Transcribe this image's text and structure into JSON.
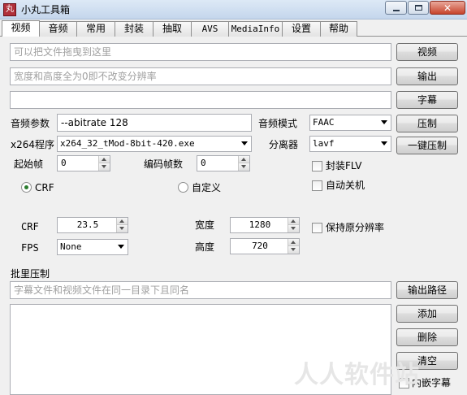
{
  "window": {
    "title": "小丸工具箱",
    "app_icon_text": "丸",
    "close": "✕"
  },
  "tabs": [
    "视频",
    "音频",
    "常用",
    "封装",
    "抽取",
    "AVS",
    "MediaInfo",
    "设置",
    "帮助"
  ],
  "video": {
    "drop_placeholder": "可以把文件拖曳到这里",
    "size_placeholder": "宽度和高度全为0即不改变分辨率",
    "subtitle_value": "",
    "btn_video": "视频",
    "btn_output": "输出",
    "btn_subtitle": "字幕",
    "audio_params_label": "音频参数",
    "audio_params_value": "--abitrate 128",
    "audio_mode_label": "音频模式",
    "audio_mode_value": "FAAC",
    "btn_compress": "压制",
    "x264_label": "x264程序",
    "x264_value": "x264_32_tMod-8bit-420.exe",
    "splitter_label": "分离器",
    "splitter_value": "lavf",
    "btn_one_click": "一键压制",
    "start_frame_label": "起始帧",
    "start_frame_value": "0",
    "encode_frames_label": "编码帧数",
    "encode_frames_value": "0",
    "mux_flv_label": "封装FLV",
    "auto_shutdown_label": "自动关机",
    "mode_crf_label": "CRF",
    "mode_custom_label": "自定义",
    "crf_label": "CRF",
    "crf_value": "23.5",
    "width_label": "宽度",
    "width_value": "1280",
    "keep_res_label": "保持原分辨率",
    "fps_label": "FPS",
    "fps_value": "None",
    "height_label": "高度",
    "height_value": "720"
  },
  "batch": {
    "title": "批里压制",
    "hint_placeholder": "字幕文件和视频文件在同一目录下且同名",
    "btn_output_path": "输出路径",
    "btn_add": "添加",
    "btn_delete": "删除",
    "btn_clear": "清空",
    "embed_sub_label": "内嵌字幕"
  },
  "watermark": "人人软件站"
}
